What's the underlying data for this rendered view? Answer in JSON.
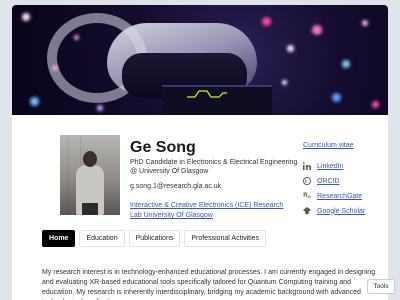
{
  "profile": {
    "name": "Ge Song",
    "role": "PhD Candidate in Electronics & Electrical Engineering @ University Of Glasgow",
    "email": "g.song.1@research.gla.ac.uk",
    "lab_link": "Interactive & Creative Electronics (ICE) Research Lab University Of Glasgow"
  },
  "sidebar": {
    "cv_label": "Curriculum vitae",
    "links": [
      {
        "icon": "linkedin-icon",
        "label": "LinkedIn"
      },
      {
        "icon": "orcid-icon",
        "label": "ORCID"
      },
      {
        "icon": "researchgate-icon",
        "label": "ResearchGate"
      },
      {
        "icon": "google-scholar-icon",
        "label": "Google Scholar"
      }
    ]
  },
  "tabs": [
    {
      "label": "Home",
      "active": true
    },
    {
      "label": "Education",
      "active": false
    },
    {
      "label": "Publications",
      "active": false
    },
    {
      "label": "Professional Activities",
      "active": false
    }
  ],
  "intro_text": "My research interest is in technology-enhanced educational processes. I am currently engaged in designing and evaluating XR-based educational tools specifically tailored for Quantum Computing training and education. My research is inherently interdisciplinary, bridging my academic background with advanced technological applications.",
  "tools_label": "Tools",
  "colors": {
    "link": "#3955c4",
    "active_tab_bg": "#000000",
    "page_bg": "#dfe3ea"
  }
}
